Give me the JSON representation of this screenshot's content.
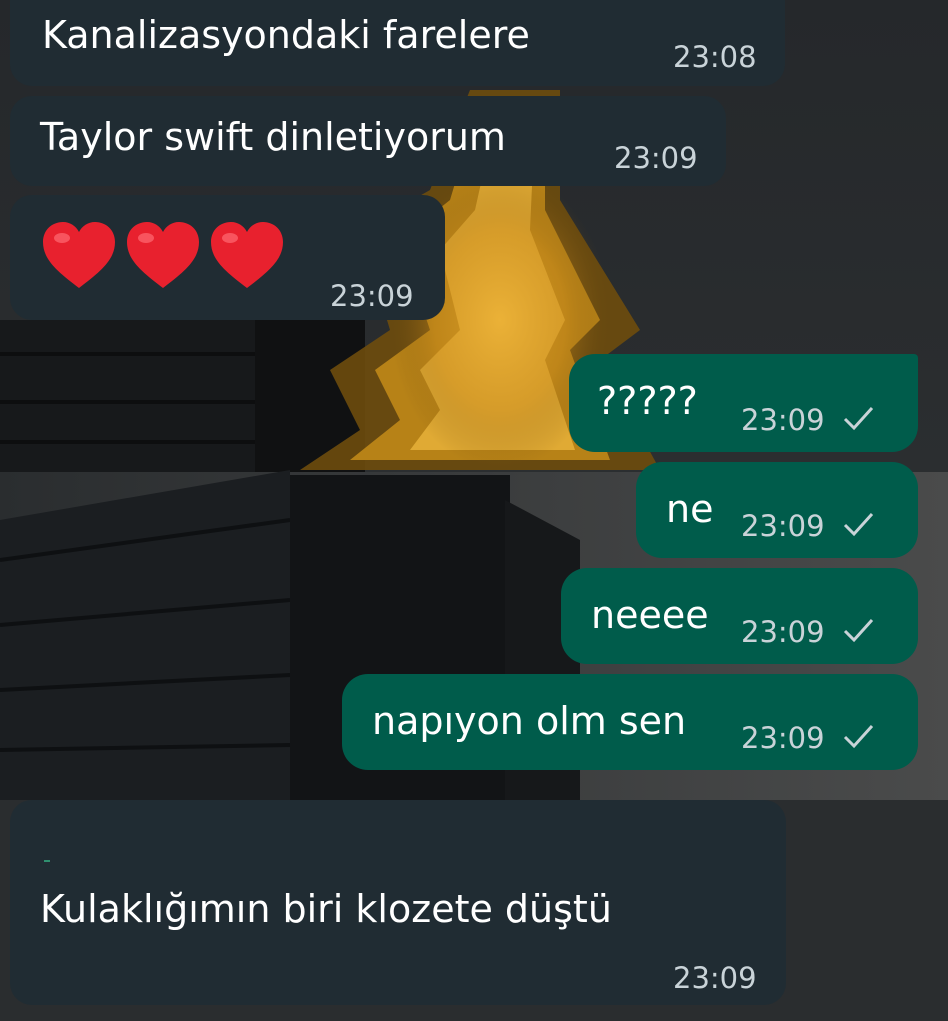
{
  "colors": {
    "incoming_bubble": "#202c33",
    "outgoing_bubble": "#005c4b",
    "text": "#ffffff",
    "timestamp": "#c9d3d8"
  },
  "messages": [
    {
      "direction": "incoming",
      "text": "Kanalizasyondaki farelere",
      "time": "23:08"
    },
    {
      "direction": "incoming",
      "text": "Taylor swift dinletiyorum",
      "time": "23:09"
    },
    {
      "direction": "incoming",
      "emoji": [
        "heart-emoji",
        "heart-emoji",
        "heart-emoji"
      ],
      "time": "23:09"
    },
    {
      "direction": "outgoing",
      "text": "?????",
      "time": "23:09",
      "status_icon": "single-check-icon"
    },
    {
      "direction": "outgoing",
      "text": "ne",
      "time": "23:09",
      "status_icon": "single-check-icon"
    },
    {
      "direction": "outgoing",
      "text": "neeee",
      "time": "23:09",
      "status_icon": "single-check-icon"
    },
    {
      "direction": "outgoing",
      "text": "napıyon olm sen",
      "time": "23:09",
      "status_icon": "single-check-icon"
    },
    {
      "direction": "incoming",
      "text": "Kulaklığımın biri klozete düştü",
      "time": "23:09"
    }
  ]
}
